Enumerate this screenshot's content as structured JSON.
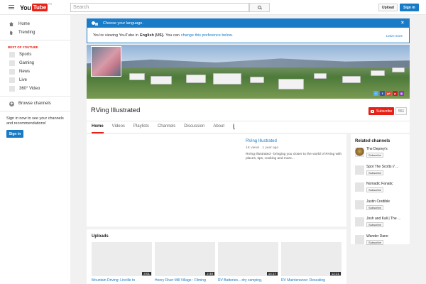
{
  "header": {
    "logo_you": "You",
    "logo_tube": "Tube",
    "logo_region": "FR",
    "search_placeholder": "Search",
    "upload_label": "Upload",
    "signin_label": "Sign in"
  },
  "sidebar": {
    "items": [
      {
        "label": "Home",
        "icon": "home-icon"
      },
      {
        "label": "Trending",
        "icon": "trending-icon"
      }
    ],
    "best_heading": "BEST OF YOUTUBE",
    "best_items": [
      "Sports",
      "Gaming",
      "News",
      "Live",
      "360° Video"
    ],
    "browse_label": "Browse channels",
    "signin_prompt": "Sign in now to see your channels and recommendations!",
    "signin_label": "Sign in"
  },
  "language_banner": {
    "heading": "Choose your language.",
    "prefix": "You're viewing YouTube in",
    "language": "English (US).",
    "middle": "You can",
    "change_link": "change this preference below.",
    "learn_more": "Learn more",
    "close": "×"
  },
  "channel": {
    "title": "RVing Illustrated",
    "subscribe_label": "Subscribe",
    "subscriber_count": "551",
    "tabs": [
      "Home",
      "Videos",
      "Playlists",
      "Channels",
      "Discussion",
      "About"
    ],
    "active_tab": "Home"
  },
  "featured": {
    "title": "RVing Illustrated",
    "meta": "1K views · 1 year ago",
    "description": "RVing Illustrated - bringing you closer to the world of RVing with places, tips, cooking and more..."
  },
  "related": {
    "heading": "Related channels",
    "subscribe_label": "Subscribe",
    "channels": [
      "The Deprey's",
      "Spot The Scotts // ...",
      "Nomadic Fanatic",
      "Justin Credible",
      "Josh and Kali | The ...",
      "Wander Dano"
    ]
  },
  "uploads": {
    "heading": "Uploads",
    "videos": [
      {
        "title": "Mountain Driving: Linville to",
        "duration": "3:01"
      },
      {
        "title": "Henry River Mill Village : Filming",
        "duration": "2:48"
      },
      {
        "title": "RV Batteries... dry camping,",
        "duration": "14:17"
      },
      {
        "title": "RV Maintenance: Resealing",
        "duration": "12:21"
      }
    ]
  },
  "colors": {
    "brand_red": "#e62117",
    "link_blue": "#167ac6",
    "banner_blue": "#1a7bc7"
  },
  "social_icons": [
    {
      "name": "twitter-icon",
      "glyph": "t",
      "color": "#55acee"
    },
    {
      "name": "facebook-icon",
      "glyph": "f",
      "color": "#3b5998"
    },
    {
      "name": "google-plus-icon",
      "glyph": "g+",
      "color": "#dd4b39"
    },
    {
      "name": "pinterest-icon",
      "glyph": "p",
      "color": "#cb2027"
    },
    {
      "name": "instagram-icon",
      "glyph": "◎",
      "color": "#8a3ab9"
    }
  ]
}
